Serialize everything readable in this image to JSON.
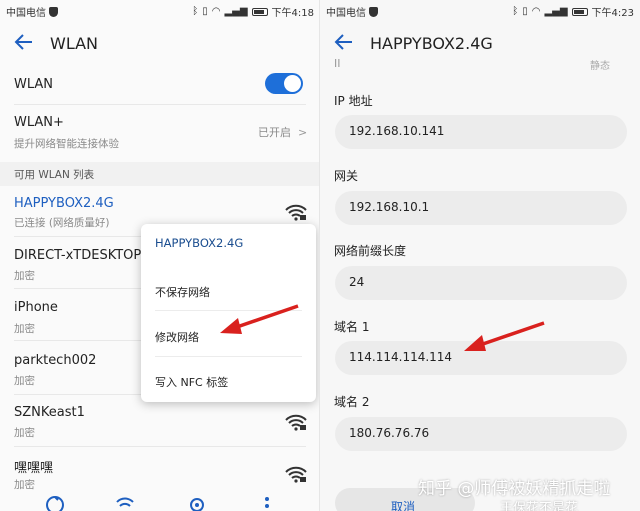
{
  "left": {
    "status": {
      "carrier": "中国电信",
      "time": "下午4:18",
      "icons": [
        "bluetooth-icon",
        "vibrate-icon",
        "wifi-status-icon",
        "signal-icon",
        "battery-icon"
      ]
    },
    "title": "WLAN",
    "wlan_label": "WLAN",
    "wlan_toggle_on": true,
    "wlanplus": {
      "title": "WLAN+",
      "subtitle": "提升网络智能连接体验",
      "state": "已开启"
    },
    "section_header": "可用 WLAN 列表",
    "networks": [
      {
        "name": "HAPPYBOX2.4G",
        "status": "已连接 (网络质量好)",
        "connected": true
      },
      {
        "name": "DIRECT-xTDESKTOP-D",
        "status": "加密"
      },
      {
        "name": "iPhone",
        "status": "加密"
      },
      {
        "name": "parktech002",
        "status": "加密"
      },
      {
        "name": "SZNKeast1",
        "status": "加密"
      },
      {
        "name": "嘿嘿嘿",
        "status": "加密"
      }
    ],
    "popup": {
      "title": "HAPPYBOX2.4G",
      "items": [
        "不保存网络",
        "修改网络",
        "写入 NFC 标签"
      ]
    },
    "bottom_icons": [
      "refresh-icon",
      "wifi-direct-icon",
      "settings-icon",
      "more-icon"
    ],
    "accent": "#1e6fd9",
    "arrow_color": "#d9211e"
  },
  "right": {
    "status": {
      "carrier": "中国电信",
      "time": "下午4:23"
    },
    "title": "HAPPYBOX2.4G",
    "top_cut_left": "II",
    "top_cut_right": "静态",
    "fields": [
      {
        "label": "IP 地址",
        "value": "192.168.10.141"
      },
      {
        "label": "网关",
        "value": "192.168.10.1"
      },
      {
        "label": "网络前缀长度",
        "value": "24"
      },
      {
        "label": "域名 1",
        "value": "114.114.114.114"
      },
      {
        "label": "域名 2",
        "value": "180.76.76.76"
      }
    ],
    "cancel": "取消",
    "watermark": "知乎 @师傅被妖精抓走啦",
    "watermark2": "王保花不是花"
  }
}
